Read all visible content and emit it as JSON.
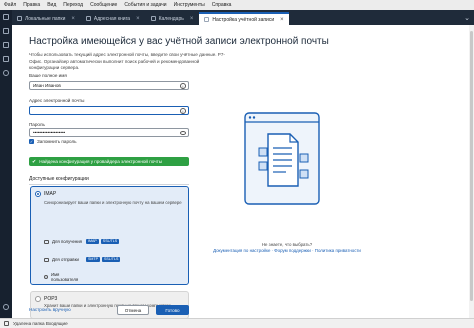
{
  "menubar": [
    "Файл",
    "Правка",
    "Вид",
    "Переход",
    "Сообщение",
    "События и задачи",
    "Инструменты",
    "Справка"
  ],
  "tabs": [
    {
      "label": "Локальные папки",
      "active": false
    },
    {
      "label": "Адресная книга",
      "active": false
    },
    {
      "label": "Календарь",
      "active": false
    },
    {
      "label": "Настройка учётной записи",
      "active": true
    }
  ],
  "page": {
    "title": "Настройка имеющейся у вас учётной записи электронной почты",
    "subtitle": "Чтобы использовать текущий адрес электронной почты, введите свои учётные данные. Р7-Офис. Органайзер автоматически выполнит поиск рабочей и рекомендованной конфигурации сервера."
  },
  "form": {
    "name_label": "Ваше полное имя",
    "name_value": "Иван Иванов",
    "email_label": "Адрес электронной почты",
    "email_value": "",
    "password_label": "Пароль",
    "password_value": "••••••••••••••••••••",
    "remember_label": "Запомнить пароль",
    "remember_checked": true
  },
  "success": {
    "text": "Найдена конфигурация у провайдера электронной почты"
  },
  "configs": {
    "heading": "Доступные конфигурации",
    "imap": {
      "title": "IMAP",
      "description": "Синхронизирует ваши папки и электронную почту на вашем сервере",
      "incoming_label": "Для получения",
      "incoming_badges": [
        "IMAP",
        "SSL/TLS"
      ],
      "outgoing_label": "Для отправки",
      "outgoing_badges": [
        "SMTP",
        "SSL/TLS"
      ],
      "username_label": "Имя пользователя"
    },
    "pop3": {
      "title": "POP3",
      "description": "Хранит ваши папки и электронную почту на вашем компьютере"
    }
  },
  "actions": {
    "manual_link": "Настроить вручную",
    "cancel": "Отмена",
    "done": "Готово"
  },
  "help": {
    "question": "Не знаете, что выбрать?",
    "links": "Документация по настройке · Форум поддержки · Политика приватности"
  },
  "status": {
    "text": "Удалена папка Входящие"
  },
  "colors": {
    "accent": "#1a5fb4",
    "success": "#2ea043",
    "sidebar": "#17212f"
  }
}
